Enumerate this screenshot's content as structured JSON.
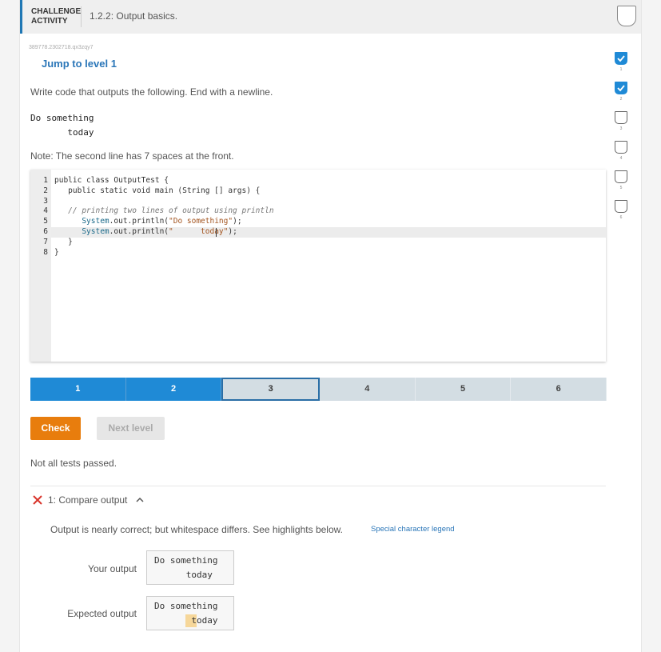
{
  "header": {
    "label_line1": "CHALLENGE",
    "label_line2": "ACTIVITY",
    "title": "1.2.2: Output basics."
  },
  "activity_id": "389778.2302718.qx3zqy7",
  "jump_link": "Jump to level 1",
  "instruction": "Write code that outputs the following. End with a newline.",
  "sample_output": [
    "Do something",
    "       today"
  ],
  "note": "Note: The second line has 7 spaces at the front.",
  "editor": {
    "lines": [
      {
        "num": "1",
        "parts": [
          {
            "t": "public class OutputTest {",
            "c": ""
          }
        ]
      },
      {
        "num": "2",
        "parts": [
          {
            "t": "   public static void main (String [] args) {",
            "c": ""
          }
        ]
      },
      {
        "num": "3",
        "parts": [
          {
            "t": "",
            "c": ""
          }
        ]
      },
      {
        "num": "4",
        "parts": [
          {
            "t": "   // printing two lines of output using println",
            "c": "comment"
          }
        ]
      },
      {
        "num": "5",
        "parts": [
          {
            "t": "      ",
            "c": ""
          },
          {
            "t": "System",
            "c": "obj"
          },
          {
            "t": ".out.println(",
            "c": ""
          },
          {
            "t": "\"Do something\"",
            "c": "str"
          },
          {
            "t": ");",
            "c": ""
          }
        ]
      },
      {
        "num": "6",
        "parts": [
          {
            "t": "      ",
            "c": ""
          },
          {
            "t": "System",
            "c": "obj"
          },
          {
            "t": ".out.println(",
            "c": ""
          },
          {
            "t": "\"      today\"",
            "c": "str"
          },
          {
            "t": ");",
            "c": ""
          }
        ]
      },
      {
        "num": "7",
        "parts": [
          {
            "t": "   }",
            "c": ""
          }
        ]
      },
      {
        "num": "8",
        "parts": [
          {
            "t": "}",
            "c": ""
          }
        ]
      }
    ]
  },
  "level_tabs": [
    {
      "label": "1",
      "state": "done"
    },
    {
      "label": "2",
      "state": "done"
    },
    {
      "label": "3",
      "state": "current"
    },
    {
      "label": "4",
      "state": "todo"
    },
    {
      "label": "5",
      "state": "todo"
    },
    {
      "label": "6",
      "state": "todo"
    }
  ],
  "buttons": {
    "check": "Check",
    "next": "Next level"
  },
  "status": "Not all tests passed.",
  "compare": {
    "label": "1: Compare output",
    "message": "Output is nearly correct; but whitespace differs. See highlights below.",
    "legend_link": "Special character legend",
    "your_label": "Your output",
    "your_lines": [
      "Do something",
      "      today"
    ],
    "expected_label": "Expected output",
    "expected_lines": [
      "Do something",
      "       today"
    ]
  },
  "progress": [
    {
      "num": "1",
      "done": true
    },
    {
      "num": "2",
      "done": true
    },
    {
      "num": "3",
      "done": false
    },
    {
      "num": "4",
      "done": false
    },
    {
      "num": "5",
      "done": false
    },
    {
      "num": "6",
      "done": false
    }
  ],
  "colors": {
    "accent": "#1f8ad6",
    "check": "#e87d0d",
    "link": "#2a76b8",
    "error": "#d9342b",
    "highlight": "#f6d79a"
  },
  "icons": {
    "fail": "x-icon",
    "collapse": "chevron-up-icon",
    "done": "checkmark-icon"
  }
}
